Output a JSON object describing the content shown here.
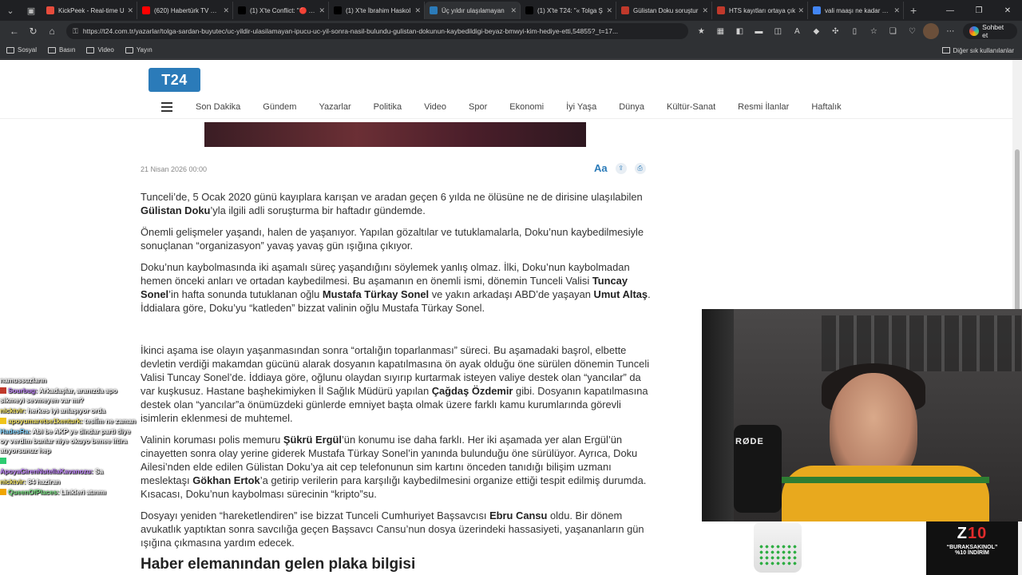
{
  "browser": {
    "tabs": [
      {
        "label": "KickPeek - Real-time U",
        "icon": "kickpeek-favicon",
        "color": "#e74c3c"
      },
      {
        "label": "(620) Habertürk TV Can",
        "icon": "youtube-favicon",
        "color": "#ff0000"
      },
      {
        "label": "(1) X'te Conflict: \"🔴 AÇ",
        "icon": "x-favicon",
        "color": "#000000"
      },
      {
        "label": "(1) X'te İbrahim Haskol",
        "icon": "x-favicon",
        "color": "#000000"
      },
      {
        "label": "Üç yıldır ulaşılamayan",
        "icon": "t24-favicon",
        "color": "#2b7bb9",
        "active": true
      },
      {
        "label": "(1) X'te T24: \"« Tolga Ş",
        "icon": "x-favicon",
        "color": "#000000"
      },
      {
        "label": "Gülistan Doku soruştur",
        "icon": "t-favicon",
        "color": "#c0392b"
      },
      {
        "label": "HTS kayıtları ortaya çık",
        "icon": "bt-favicon",
        "color": "#c0392b"
      },
      {
        "label": "vali maaşı ne kadar 202",
        "icon": "google-favicon",
        "color": "#4285f4"
      }
    ],
    "url": "https://t24.com.tr/yazarlar/tolga-sardan-buyutec/uc-yildir-ulasilamayan-ipucu-uc-yil-sonra-nasil-bulundu-gulistan-dokunun-kaybedildigi-beyaz-bmwyi-kim-hediye-etti,54855?_t=17...",
    "copilot_label": "Sohbet et",
    "bookmarks": [
      "Sosyal",
      "Basın",
      "Video",
      "Yayın"
    ],
    "bookmarks_other": "Diğer sık kullanılanlar"
  },
  "site": {
    "logo": "T24",
    "nav": [
      "Son Dakika",
      "Gündem",
      "Yazarlar",
      "Politika",
      "Video",
      "Spor",
      "Ekonomi",
      "İyi Yaşa",
      "Dünya",
      "Kültür-Sanat",
      "Resmi İlanlar",
      "Haftalık"
    ],
    "date": "21 Nisan 2026 00:00",
    "font_toggle": "Aa"
  },
  "article": {
    "p1_a": "Tunceli’de, 5 Ocak 2020 günü kayıplara karışan ve aradan geçen 6 yılda ne ölüsüne ne de dirisine ulaşılabilen ",
    "p1_b": "Gülistan Doku",
    "p1_c": "’yla ilgili adli soruşturma bir haftadır gündemde.",
    "p2": "Önemli gelişmeler yaşandı, halen de yaşanıyor. Yapılan gözaltılar ve tutuklamalarla, Doku’nun kaybedilmesiyle sonuçlanan “organizasyon” yavaş yavaş gün ışığına çıkıyor.",
    "p3_a": "Doku’nun kaybolmasında iki aşamalı süreç yaşandığını söylemek yanlış olmaz. İlki, Doku’nun kaybolmadan hemen önceki anları ve ortadan kaybedilmesi. Bu aşamanın en önemli ismi, dönemin Tunceli Valisi ",
    "p3_b": "Tuncay Sonel",
    "p3_c": "’in hafta sonunda tutuklanan oğlu ",
    "p3_d": "Mustafa Türkay Sonel",
    "p3_e": " ve yakın arkadaşı ABD’de yaşayan ",
    "p3_f": "Umut Altaş",
    "p3_g": ". İddialara göre, Doku’yu “katleden” bizzat valinin oğlu Mustafa Türkay Sonel.",
    "p4_a": "İkinci aşama ise olayın yaşanmasından sonra “ortalığın toparlanması” süreci. Bu aşamadaki başrol, elbette devletin verdiği makamdan gücünü alarak dosyanın kapatılmasına ön ayak olduğu öne sürülen dönemin Tunceli Valisi Tuncay Sonel’de. İddiaya göre, oğlunu olaydan sıyırıp kurtarmak isteyen valiye destek olan “yancılar” da var kuşkusuz. Hastane başhekimiyken İl Sağlık Müdürü yapılan ",
    "p4_b": "Çağdaş Özdemir",
    "p4_c": " gibi. Dosyanın kapatılmasına destek olan “yancılar”a önümüzdeki günlerde emniyet başta olmak üzere farklı kamu kurumlarında görevli isimlerin eklenmesi de muhtemel.",
    "p5_a": "Valinin koruması polis memuru ",
    "p5_b": "Şükrü Ergül",
    "p5_c": "’ün konumu ise daha farklı. Her iki aşamada yer alan Ergül’ün cinayetten sonra olay yerine giderek Mustafa Türkay Sonel’in yanında bulunduğu öne sürülüyor. Ayrıca, Doku Ailesi’nden elde edilen Gülistan Doku’ya ait cep telefonunun sim kartını önceden tanıdığı bilişim uzmanı meslektaşı ",
    "p5_d": "Gökhan Ertok",
    "p5_e": "’a getirip verilerin para karşılığı kaybedilmesini organize ettiği tespit edilmiş durumda. Kısacası, Doku’nun kaybolması sürecinin “kripto”su.",
    "p6_a": "Dosyayı yeniden “hareketlendiren” ise bizzat Tunceli Cumhuriyet Başsavcısı ",
    "p6_b": "Ebru Cansu",
    "p6_c": " oldu. Bir dönem avukatlık yaptıktan sonra savcılığa geçen Başsavcı Cansu’nun dosya üzerindeki hassasiyeti, yaşananların gün ışığına çıkmasına yardım edecek.",
    "h2": "Haber elemanından gelen plaka bilgisi"
  },
  "chat": [
    {
      "name": "",
      "text": "namussuzların",
      "color": "#ffffff"
    },
    {
      "name": "Sourbug:",
      "text": " Arkadaşlar, aranızda apo sikmeyi sevmeyen var mı?",
      "color": "#c084fc",
      "badge": "#c0392b"
    },
    {
      "name": "nicktvir:",
      "text": " herkes iyi anlaşıyor orda",
      "color": "#f5e663"
    },
    {
      "name": "apoyumaretse1kenturk:",
      "text": " tesli̇m ne zaman",
      "color": "#f5e663",
      "badge": "#f0c419"
    },
    {
      "name": "HadesRa:",
      "text": " Abi be AKP ye dindar parti diye oy verdim bunlar niye okuyo benee iftira atıyorsunuz hep",
      "color": "#7fd3ff"
    },
    {
      "name": "",
      "text": "",
      "color": "#ffffff",
      "badge": "#2ecc71"
    },
    {
      "name": "ApoyaGirenNutellaKavanozu:",
      "text": " Sa",
      "color": "#c084fc"
    },
    {
      "name": "nicktvir:",
      "text": " 84 haziran",
      "color": "#f5e663"
    },
    {
      "name": "QueenOfPlaces:",
      "text": " Linkleri atınmı",
      "color": "#7ee787",
      "badge": "#f0a500"
    }
  ],
  "stream": {
    "mic_brand": "RØDE",
    "promo_title": "Z10",
    "promo_code": "“BURAKSAKINOL”",
    "promo_discount": "%10 İNDİRİM"
  }
}
